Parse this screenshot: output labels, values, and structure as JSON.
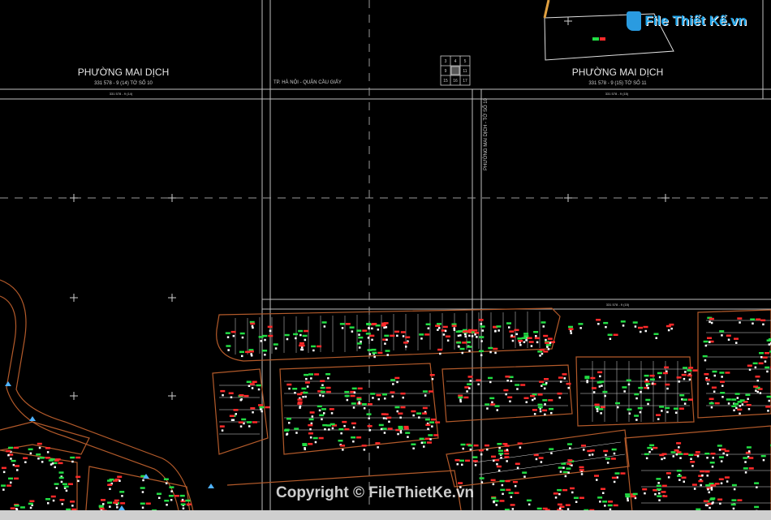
{
  "drawing": {
    "ward_left": "PHƯỜNG MAI DỊCH",
    "ward_left_code": "331 578 - 9 (14) TỜ SỐ 10",
    "ward_right": "PHƯỜNG MAI DỊCH",
    "ward_right_code": "331 578 - 9 (15) TỜ SỐ 11",
    "city_label": "TP. HÀ NỘI - QUẬN CẦU GIẤY",
    "vertical_label": "PHƯỜNG MAI DỊCH - TỜ SỐ 10",
    "sheet_code_left": "331 578 - 9 (14)",
    "sheet_code_right": "331 578 - 9 (15)",
    "index_grid": [
      "3",
      "4",
      "5",
      "9",
      "",
      "11",
      "15",
      "16",
      "17"
    ],
    "colors": {
      "background": "#000000",
      "grid": "#bfbfbf",
      "parcel": "#b35a2a",
      "building_red": "#ff2a2a",
      "building_green": "#22dd44",
      "text": "#e6e6e6"
    }
  },
  "watermark": {
    "logo_text": "File Thiết Kế.vn",
    "copyright": "Copyright © FileThietKe.vn"
  }
}
